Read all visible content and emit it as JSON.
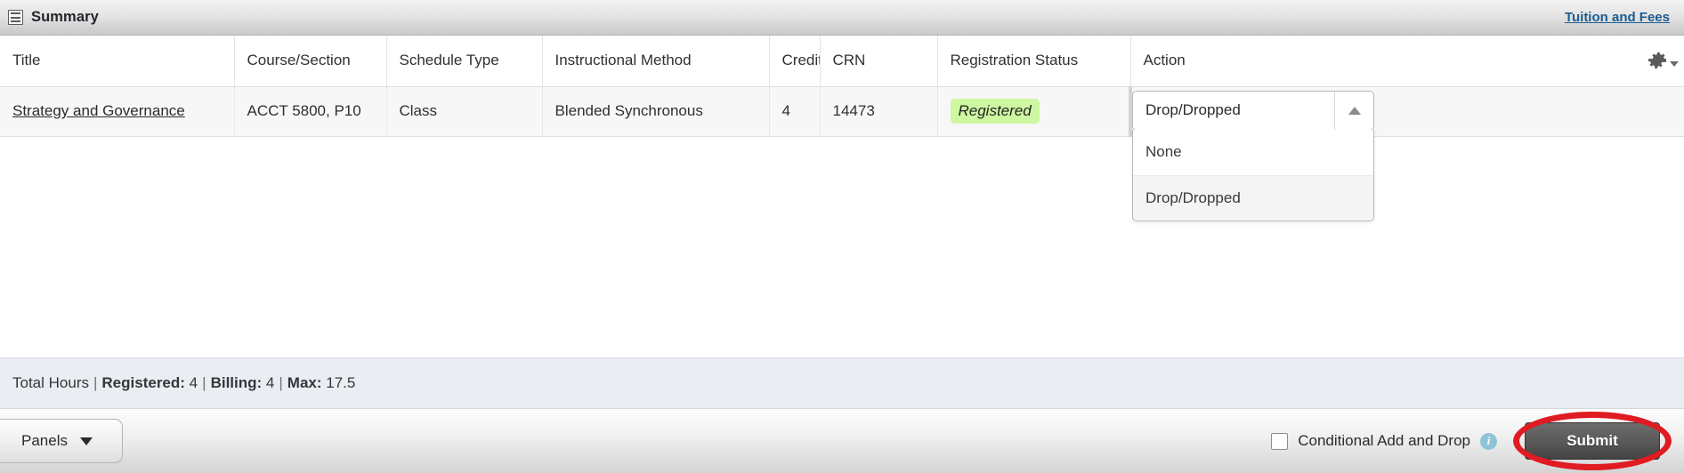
{
  "panel": {
    "title": "Summary",
    "icon": "grid-icon",
    "tuition_link": "Tuition and Fees",
    "settings_icon": "gear-icon"
  },
  "table": {
    "columns": [
      "Title",
      "Course/Section",
      "Schedule Type",
      "Instructional Method",
      "Credits",
      "CRN",
      "Registration Status",
      "Action"
    ],
    "rows": [
      {
        "title": "Strategy and Governance",
        "course_section": "ACCT 5800, P10",
        "schedule_type": "Class",
        "instructional_method": "Blended Synchronous",
        "credits": "4",
        "crn": "14473",
        "registration_status": "Registered",
        "action_value": "Drop/Dropped"
      }
    ]
  },
  "action_dropdown": {
    "selected": "Drop/Dropped",
    "expanded": true,
    "options": [
      {
        "label": "None",
        "selected": false
      },
      {
        "label": "Drop/Dropped",
        "selected": true
      }
    ]
  },
  "totals": {
    "label": "Total Hours",
    "registered_label": "Registered:",
    "registered_value": "4",
    "billing_label": "Billing:",
    "billing_value": "4",
    "max_label": "Max:",
    "max_value": "17.5",
    "separator": "|"
  },
  "bottom_bar": {
    "panels_label": "Panels",
    "conditional_label": "Conditional Add and Drop",
    "conditional_checked": false,
    "info_icon": "info-icon",
    "info_glyph": "i",
    "submit_label": "Submit"
  },
  "colors": {
    "link": "#1a5c93",
    "status_badge_bg": "#cdf7a0",
    "annotation_ring": "#e01b22",
    "totals_bg": "#eaeef3",
    "submit_bg": "#4e4e4e"
  }
}
